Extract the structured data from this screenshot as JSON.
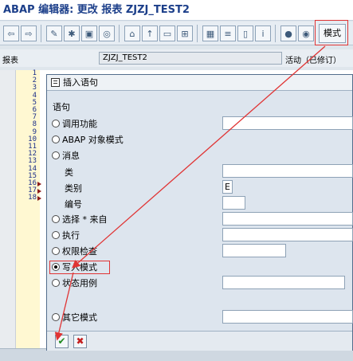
{
  "window": {
    "title": "ABAP 编辑器: 更改 报表 ZJZJ_TEST2"
  },
  "toolbar": {
    "mode_label": "模式",
    "icons": [
      "back-icon",
      "forward-icon",
      "edit-icon",
      "activate-icon",
      "check-icon",
      "where-used-icon",
      "object-list-icon",
      "display-object-list-icon",
      "navigation-window-icon",
      "enhance-icon",
      "pattern-icon",
      "pretty-printer-icon",
      "insert-icon",
      "info-icon",
      "breakpoint-icon",
      "breakpoint-session-icon"
    ]
  },
  "info_row": {
    "report_label": "报表",
    "report_name": "ZJZJ_TEST2",
    "status": "活动（已修订）"
  },
  "editor": {
    "line_numbers": [
      "1",
      "2",
      "3",
      "4",
      "5",
      "6",
      "7",
      "8",
      "9",
      "10",
      "11",
      "12",
      "13",
      "14",
      "15",
      "16",
      "17",
      "18"
    ],
    "marked_lines": [
      "16",
      "17",
      "18"
    ]
  },
  "dialog": {
    "title": "插入语句",
    "section_label": "语句",
    "options": {
      "call_function": "调用功能",
      "abap_object_pattern": "ABAP 对象模式",
      "message": "消息",
      "select_from": "选择 * 来自",
      "perform": "执行",
      "authority_check": "权限检查",
      "write_pattern": "写入模式",
      "case_for_status": "状态用例",
      "other_pattern": "其它模式"
    },
    "message_fields": {
      "class_label": "类",
      "type_label": "类别",
      "type_value": "E",
      "number_label": "编号"
    },
    "selected_option": "写入模式",
    "footer": {
      "ok_label": "✔",
      "cancel_label": "✖"
    }
  },
  "colors": {
    "annotation": "#e03434",
    "title": "#1c3f8a"
  }
}
